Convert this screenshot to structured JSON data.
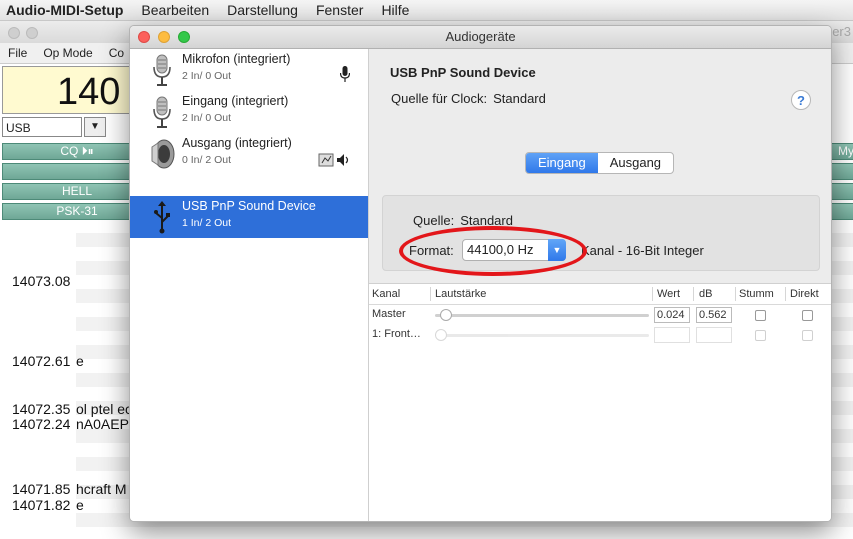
{
  "menubar": {
    "app": "Audio-MIDI-Setup",
    "items": [
      "Bearbeiten",
      "Darstellung",
      "Fenster",
      "Hilfe"
    ]
  },
  "background_app": {
    "title_fragment": "er3",
    "menu": [
      "File",
      "Op Mode",
      "Co"
    ],
    "frequency_fragment": "140",
    "mode_value": "USB",
    "buttons": [
      "CQ ⏵⏸",
      "",
      "HELL",
      "PSK-31"
    ],
    "right_button": "My",
    "log": [
      {
        "freq": "14073.08",
        "text": ""
      },
      {
        "freq": "14072.61",
        "text": "e"
      },
      {
        "freq": "14072.35",
        "text": "ol ptel ec"
      },
      {
        "freq": "14072.24",
        "text": "nA0AEP"
      },
      {
        "freq": "14071.85",
        "text": "hcraft M"
      },
      {
        "freq": "14071.82",
        "text": "e"
      }
    ]
  },
  "dialog": {
    "title": "Audiogeräte",
    "devices": [
      {
        "name": "Mikrofon (integriert)",
        "io": "2 In/ 0 Out",
        "icon": "microphone-icon"
      },
      {
        "name": "Eingang (integriert)",
        "io": "2 In/ 0 Out",
        "icon": "microphone-icon"
      },
      {
        "name": "Ausgang (integriert)",
        "io": "0 In/ 2 Out",
        "icon": "speaker-icon"
      },
      {
        "name": "USB PnP Sound Device",
        "io": "1 In/ 2 Out",
        "icon": "usb-icon"
      }
    ],
    "footer": {
      "add": "+",
      "remove": "−",
      "gear": "⚙"
    },
    "detail": {
      "device_name": "USB PnP Sound Device",
      "clock_label": "Quelle für Clock:",
      "clock_value": "Standard",
      "help": "?",
      "tabs": [
        "Eingang",
        "Ausgang"
      ],
      "source_label": "Quelle:",
      "source_value": "Standard",
      "format_label": "Format:",
      "format_value": "44100,0 Hz",
      "format_rest": "Kanal - 16-Bit Integer"
    },
    "table": {
      "headers": [
        "Kanal",
        "Lautstärke",
        "Wert",
        "dB",
        "Stumm",
        "Direkt"
      ],
      "rows": [
        {
          "name": "Master",
          "value": "0.024",
          "db": "0.562",
          "volume_level": 0.024
        },
        {
          "name": "1: Front…",
          "value": "",
          "db": "",
          "volume_level": 0.0
        }
      ]
    }
  },
  "colors": {
    "selection": "#2e6fd9",
    "highlight_ellipse": "#e3161a",
    "green_button": "#7fb5a5"
  }
}
